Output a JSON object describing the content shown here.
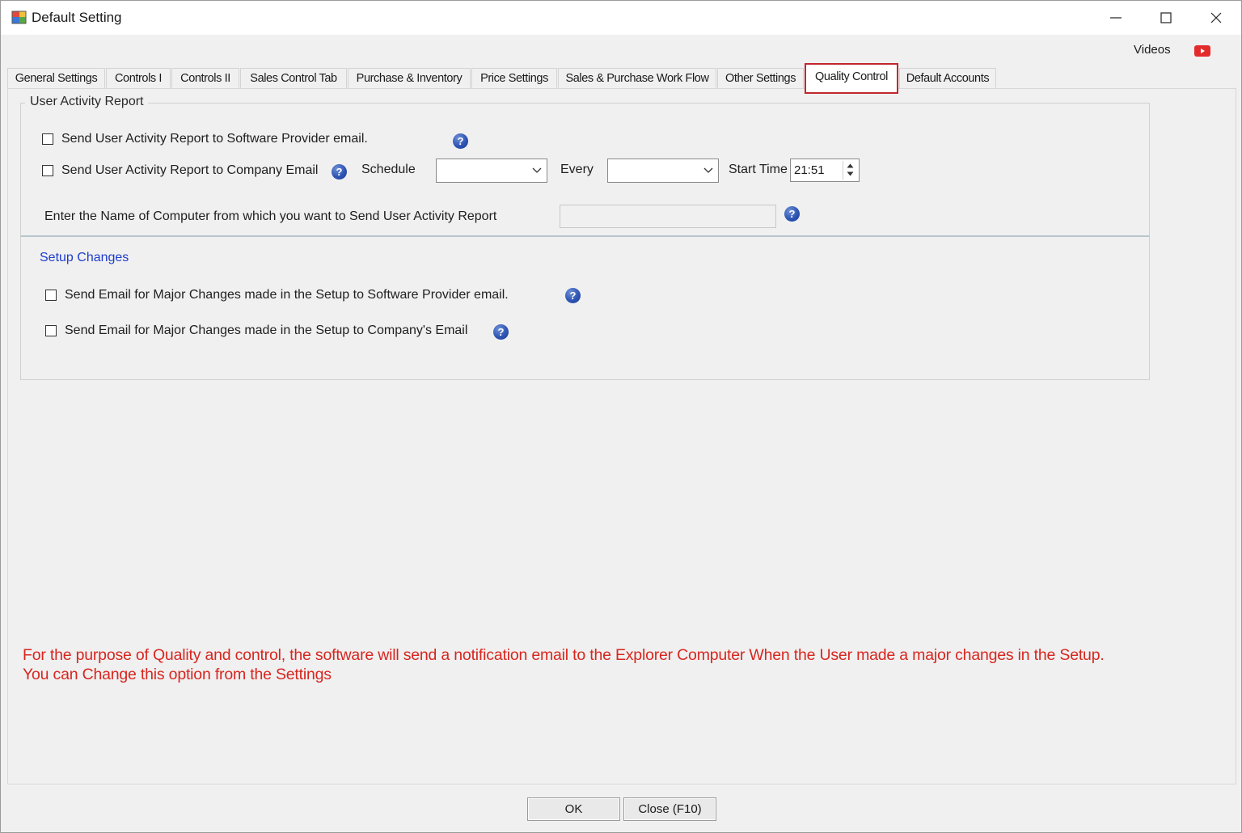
{
  "window": {
    "title": "Default Setting",
    "videos_label": "Videos"
  },
  "tabs": [
    {
      "label": "General Settings"
    },
    {
      "label": "Controls I"
    },
    {
      "label": "Controls II"
    },
    {
      "label": "Sales Control Tab"
    },
    {
      "label": "Purchase & Inventory"
    },
    {
      "label": "Price Settings"
    },
    {
      "label": "Sales & Purchase Work Flow"
    },
    {
      "label": "Other Settings"
    },
    {
      "label": "Quality Control",
      "active": true
    },
    {
      "label": "Default Accounts"
    }
  ],
  "user_activity": {
    "legend": "User Activity Report",
    "send_provider_label": "Send User Activity Report to Software Provider email.",
    "send_company_label": "Send User Activity Report to Company Email",
    "schedule_label": "Schedule",
    "schedule_value": "",
    "every_label": "Every",
    "every_value": "",
    "start_time_label": "Start Time",
    "start_time_value": "21:51",
    "computer_name_label": "Enter the Name of Computer from which you want to  Send User Activity Report",
    "computer_name_value": ""
  },
  "setup_changes": {
    "title": "Setup Changes",
    "provider_label": "Send Email for Major Changes made in the Setup to Software Provider email.",
    "company_label": "Send Email for Major Changes made in the Setup to Company's Email"
  },
  "notice": "For the purpose of Quality and control, the software will send a notification email to the Explorer Computer When the User made a major changes in the Setup. You can Change this option from the Settings",
  "buttons": {
    "ok": "OK",
    "close": "Close (F10)"
  },
  "help_glyph": "?",
  "colors": {
    "notice_red": "#d8261f",
    "active_tab_border": "#c1272d",
    "setup_changes_blue": "#1e3ccc",
    "help_blue": "#2e55b4",
    "youtube_red": "#e32b2b"
  },
  "icons": [
    "app-icon",
    "minimize-icon",
    "maximize-icon",
    "close-icon",
    "youtube-icon",
    "help-icon",
    "dropdown-arrow-icon",
    "spin-up-icon",
    "spin-down-icon"
  ]
}
